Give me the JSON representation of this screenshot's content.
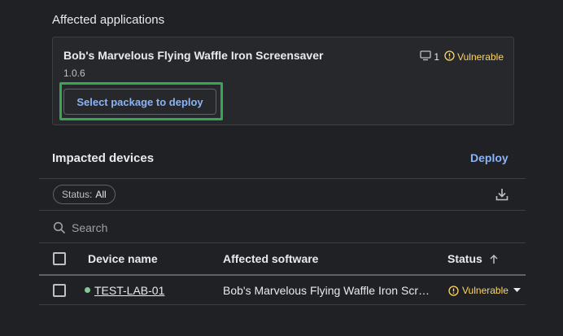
{
  "affected_applications": {
    "title": "Affected applications",
    "app": {
      "name": "Bob's Marvelous Flying Waffle Iron Screensaver",
      "version": "1.0.6",
      "device_count": "1",
      "status": "Vulnerable",
      "action_label": "Select package to deploy"
    }
  },
  "impacted_devices": {
    "title": "Impacted devices",
    "deploy_label": "Deploy",
    "filter": {
      "label": "Status:",
      "value": "All"
    },
    "search": {
      "placeholder": "Search"
    },
    "table": {
      "columns": [
        "Device name",
        "Affected software",
        "Status"
      ],
      "rows": [
        {
          "device_name": "TEST-LAB-01",
          "affected_software": "Bob's Marvelous Flying Waffle Iron Scr…",
          "status": "Vulnerable"
        }
      ]
    }
  },
  "colors": {
    "background": "#202124",
    "accent": "#8ab4f8",
    "warning": "#fdd663",
    "online": "#81c995",
    "highlight": "#34a853"
  }
}
